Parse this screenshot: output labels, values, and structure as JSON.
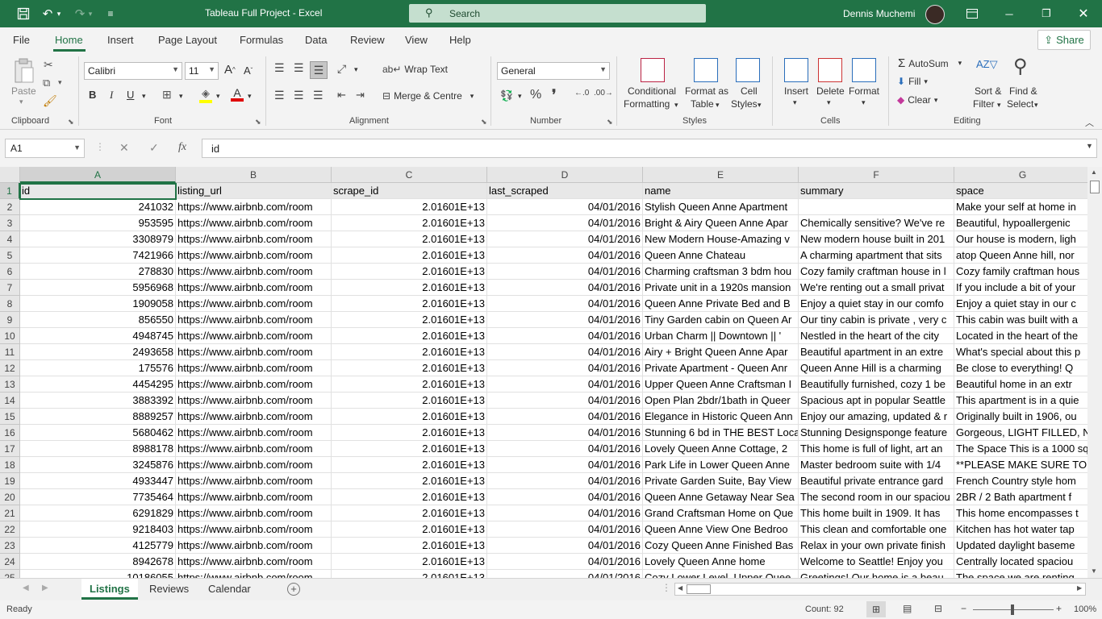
{
  "window": {
    "title": "Tableau Full Project  -  Excel",
    "search_label": "Search",
    "user_name": "Dennis Muchemi",
    "accent": "#217346"
  },
  "tabs": [
    "File",
    "Home",
    "Insert",
    "Page Layout",
    "Formulas",
    "Data",
    "Review",
    "View",
    "Help"
  ],
  "active_tab": "Home",
  "share_label": "Share",
  "ribbon": {
    "clipboard": {
      "label": "Clipboard",
      "paste": "Paste"
    },
    "font": {
      "label": "Font",
      "name": "Calibri",
      "size": "11",
      "bold": "B",
      "italic": "I",
      "underline": "U"
    },
    "alignment": {
      "label": "Alignment",
      "wrap": "Wrap Text",
      "merge": "Merge & Centre"
    },
    "number": {
      "label": "Number",
      "format": "General"
    },
    "styles": {
      "label": "Styles",
      "cond1": "Conditional",
      "cond2": "Formatting",
      "fmt1": "Format as",
      "fmt2": "Table",
      "cell1": "Cell",
      "cell2": "Styles"
    },
    "cells": {
      "label": "Cells",
      "insert": "Insert",
      "delete": "Delete",
      "format": "Format"
    },
    "editing": {
      "label": "Editing",
      "autosum": "AutoSum",
      "fill": "Fill",
      "clear": "Clear",
      "sort1": "Sort &",
      "sort2": "Filter",
      "find1": "Find &",
      "find2": "Select"
    }
  },
  "formula_bar": {
    "name_box": "A1",
    "content": "id"
  },
  "columns": [
    "A",
    "B",
    "C",
    "D",
    "E",
    "F",
    "G"
  ],
  "header_row": [
    "id",
    "listing_url",
    "scrape_id",
    "last_scraped",
    "name",
    "summary",
    "space"
  ],
  "rows": [
    {
      "n": "2",
      "id": "241032",
      "url": "https://www.airbnb.com/room",
      "scrape": "2.01601E+13",
      "date": "04/01/2016",
      "name": "Stylish Queen Anne Apartment",
      "summary": "",
      "space": "Make your self at home in"
    },
    {
      "n": "3",
      "id": "953595",
      "url": "https://www.airbnb.com/room",
      "scrape": "2.01601E+13",
      "date": "04/01/2016",
      "name": "Bright & Airy Queen Anne Apar",
      "summary": "Chemically sensitive? We've re",
      "space": "Beautiful, hypoallergenic"
    },
    {
      "n": "4",
      "id": "3308979",
      "url": "https://www.airbnb.com/room",
      "scrape": "2.01601E+13",
      "date": "04/01/2016",
      "name": "New Modern House-Amazing v",
      "summary": "New modern house built in 201",
      "space": "Our house is modern, ligh"
    },
    {
      "n": "5",
      "id": "7421966",
      "url": "https://www.airbnb.com/room",
      "scrape": "2.01601E+13",
      "date": "04/01/2016",
      "name": "Queen Anne Chateau",
      "summary": "A charming apartment that sits",
      "space": "atop Queen Anne hill, nor"
    },
    {
      "n": "6",
      "id": "278830",
      "url": "https://www.airbnb.com/room",
      "scrape": "2.01601E+13",
      "date": "04/01/2016",
      "name": "Charming craftsman 3 bdm hou",
      "summary": "Cozy family craftman house in l",
      "space": "Cozy family craftman hous"
    },
    {
      "n": "7",
      "id": "5956968",
      "url": "https://www.airbnb.com/room",
      "scrape": "2.01601E+13",
      "date": "04/01/2016",
      "name": "Private unit in a 1920s mansion",
      "summary": "We're renting out a small privat",
      "space": "If you include a bit of your"
    },
    {
      "n": "8",
      "id": "1909058",
      "url": "https://www.airbnb.com/room",
      "scrape": "2.01601E+13",
      "date": "04/01/2016",
      "name": "Queen Anne Private Bed and B",
      "summary": "Enjoy a quiet stay in our comfo",
      "space": "Enjoy a quiet stay in our c"
    },
    {
      "n": "9",
      "id": "856550",
      "url": "https://www.airbnb.com/room",
      "scrape": "2.01601E+13",
      "date": "04/01/2016",
      "name": "Tiny Garden cabin on Queen Ar",
      "summary": "Our tiny cabin is private , very c",
      "space": "This cabin was built with a"
    },
    {
      "n": "10",
      "id": "4948745",
      "url": "https://www.airbnb.com/room",
      "scrape": "2.01601E+13",
      "date": "04/01/2016",
      "name": "Urban Charm || Downtown || '",
      "summary": "Nestled in the heart of the city",
      "space": "Located in the heart of the"
    },
    {
      "n": "11",
      "id": "2493658",
      "url": "https://www.airbnb.com/room",
      "scrape": "2.01601E+13",
      "date": "04/01/2016",
      "name": "Airy + Bright Queen Anne Apar",
      "summary": "Beautiful apartment in an extre",
      "space": "What's special about this p"
    },
    {
      "n": "12",
      "id": "175576",
      "url": "https://www.airbnb.com/room",
      "scrape": "2.01601E+13",
      "date": "04/01/2016",
      "name": "Private Apartment - Queen Anr",
      "summary": "Queen Anne Hill is a charming",
      "space": "Be close to everything!  Q"
    },
    {
      "n": "13",
      "id": "4454295",
      "url": "https://www.airbnb.com/room",
      "scrape": "2.01601E+13",
      "date": "04/01/2016",
      "name": "Upper Queen Anne Craftsman I",
      "summary": "Beautifully furnished, cozy 1 be",
      "space": "Beautiful home in an extr"
    },
    {
      "n": "14",
      "id": "3883392",
      "url": "https://www.airbnb.com/room",
      "scrape": "2.01601E+13",
      "date": "04/01/2016",
      "name": "Open Plan 2bdr/1bath in Queer",
      "summary": "Spacious apt in popular Seattle",
      "space": "This apartment is in a quie"
    },
    {
      "n": "15",
      "id": "8889257",
      "url": "https://www.airbnb.com/room",
      "scrape": "2.01601E+13",
      "date": "04/01/2016",
      "name": "Elegance in Historic Queen Ann",
      "summary": "Enjoy our amazing, updated & r",
      "space": "Originally built in 1906, ou"
    },
    {
      "n": "16",
      "id": "5680462",
      "url": "https://www.airbnb.com/room",
      "scrape": "2.01601E+13",
      "date": "04/01/2016",
      "name": "Stunning 6 bd in THE BEST Locat",
      "summary": "Stunning Designsponge feature",
      "space": "Gorgeous, LIGHT FILLED, N"
    },
    {
      "n": "17",
      "id": "8988178",
      "url": "https://www.airbnb.com/room",
      "scrape": "2.01601E+13",
      "date": "04/01/2016",
      "name": "Lovely Queen Anne Cottage, 2",
      "summary": "This home is full of light, art an",
      "space": "The Space This is a 1000 sq"
    },
    {
      "n": "18",
      "id": "3245876",
      "url": "https://www.airbnb.com/room",
      "scrape": "2.01601E+13",
      "date": "04/01/2016",
      "name": "Park Life in Lower Queen Anne",
      "summary": "Master bedroom suite with 1/4",
      "space": "**PLEASE MAKE SURE TO R"
    },
    {
      "n": "19",
      "id": "4933447",
      "url": "https://www.airbnb.com/room",
      "scrape": "2.01601E+13",
      "date": "04/01/2016",
      "name": "Private Garden Suite, Bay View",
      "summary": "Beautiful private entrance gard",
      "space": "French Country style hom"
    },
    {
      "n": "20",
      "id": "7735464",
      "url": "https://www.airbnb.com/room",
      "scrape": "2.01601E+13",
      "date": "04/01/2016",
      "name": "Queen Anne Getaway Near Sea",
      "summary": "The second room in our spaciou",
      "space": "2BR / 2 Bath apartment f"
    },
    {
      "n": "21",
      "id": "6291829",
      "url": "https://www.airbnb.com/room",
      "scrape": "2.01601E+13",
      "date": "04/01/2016",
      "name": "Grand Craftsman Home on Que",
      "summary": "This  home built in 1909.  It has",
      "space": "This home encompasses t"
    },
    {
      "n": "22",
      "id": "9218403",
      "url": "https://www.airbnb.com/room",
      "scrape": "2.01601E+13",
      "date": "04/01/2016",
      "name": "Queen Anne View One Bedroo",
      "summary": "This clean and comfortable one",
      "space": "Kitchen has hot water tap"
    },
    {
      "n": "23",
      "id": "4125779",
      "url": "https://www.airbnb.com/room",
      "scrape": "2.01601E+13",
      "date": "04/01/2016",
      "name": "Cozy Queen Anne Finished Bas",
      "summary": "Relax in your own private finish",
      "space": "Updated daylight baseme"
    },
    {
      "n": "24",
      "id": "8942678",
      "url": "https://www.airbnb.com/room",
      "scrape": "2.01601E+13",
      "date": "04/01/2016",
      "name": "Lovely Queen Anne home",
      "summary": "Welcome to Seattle! Enjoy you",
      "space": "Centrally located spaciou"
    },
    {
      "n": "25",
      "id": "10186055",
      "url": "https://www.airbnb.com/room",
      "scrape": "2.01601E+13",
      "date": "04/01/2016",
      "name": "Cozy Lower Level, Upper Quee",
      "summary": "Greetings!  Our home is a beau",
      "space": "The space we are renting"
    }
  ],
  "sheets": [
    "Listings",
    "Reviews",
    "Calendar"
  ],
  "active_sheet": "Listings",
  "status": {
    "ready": "Ready",
    "count": "Count: 92",
    "zoom": "100%"
  }
}
